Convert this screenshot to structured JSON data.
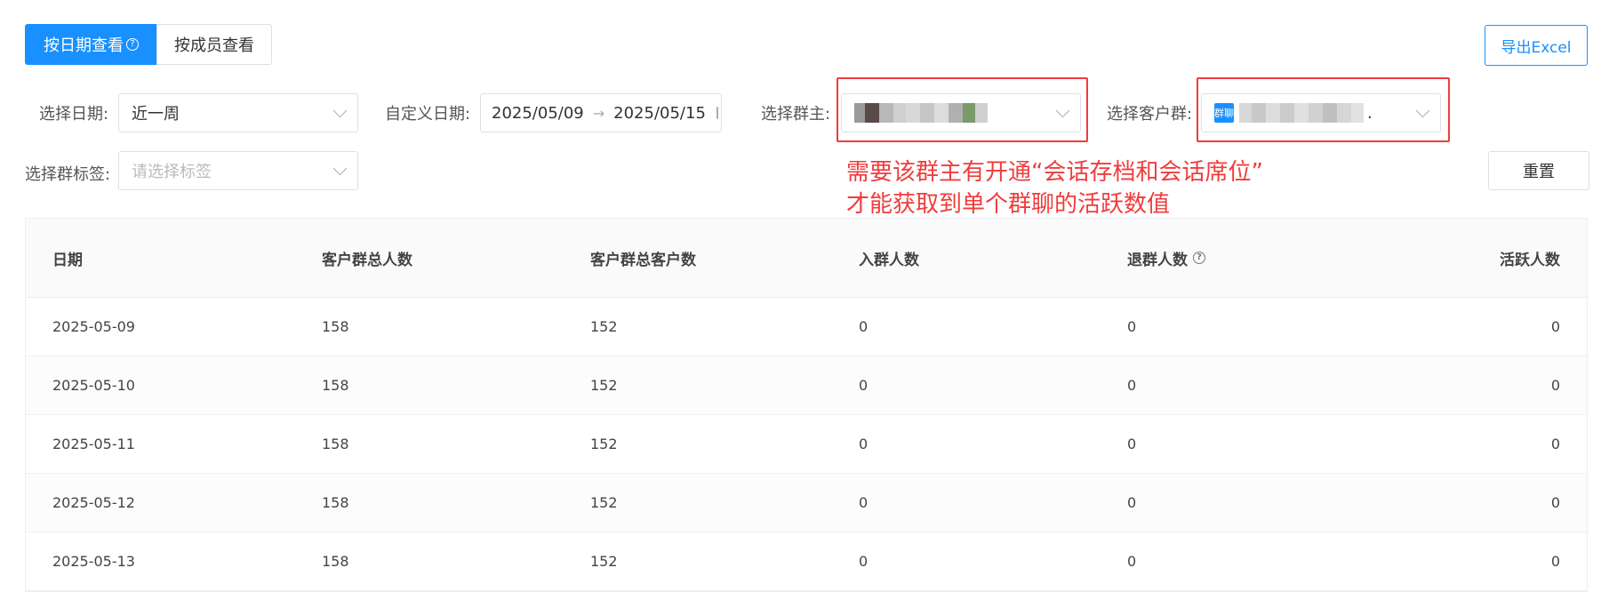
{
  "tabs": [
    {
      "label": "按日期查看",
      "active": true,
      "has_help": true
    },
    {
      "label": "按成员查看",
      "active": false
    }
  ],
  "help_glyph": "?",
  "export_label": "导出Excel",
  "filters": {
    "date_label": "选择日期:",
    "date_value": "近一周",
    "custom_date_label": "自定义日期:",
    "start_date": "2025/05/09",
    "end_date": "2025/05/15",
    "range_arrow": "→",
    "owner_label": "选择群主:",
    "group_label": "选择客户群:",
    "group_icon_text": "群聊",
    "group_tail": ".",
    "tag_label": "选择群标签:",
    "tag_placeholder": "请选择标签"
  },
  "note": {
    "line1": "需要该群主有开通“会话存档和会话席位”",
    "line2": "才能获取到单个群聊的活跃数值"
  },
  "reset_label": "重置",
  "table": {
    "headers": [
      "日期",
      "客户群总人数",
      "客户群总客户数",
      "入群人数",
      "退群人数",
      "活跃人数"
    ],
    "rows": [
      [
        "2025-05-09",
        "158",
        "152",
        "0",
        "0",
        "0"
      ],
      [
        "2025-05-10",
        "158",
        "152",
        "0",
        "0",
        "0"
      ],
      [
        "2025-05-11",
        "158",
        "152",
        "0",
        "0",
        "0"
      ],
      [
        "2025-05-12",
        "158",
        "152",
        "0",
        "0",
        "0"
      ],
      [
        "2025-05-13",
        "158",
        "152",
        "0",
        "0",
        "0"
      ]
    ]
  },
  "colors": {
    "primary": "#1890ff",
    "annotation": "#f03c3c"
  }
}
